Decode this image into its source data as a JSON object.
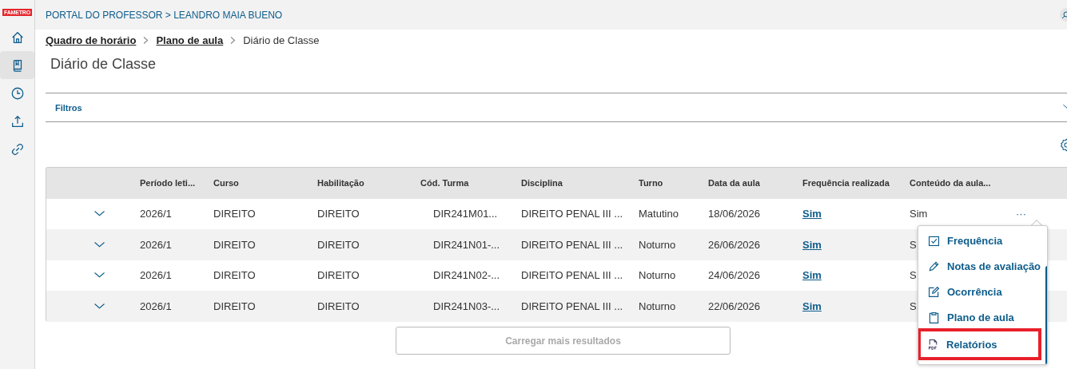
{
  "sidebar": {
    "logo": "FAMETRO",
    "items": [
      {
        "kind": "home",
        "selected": false
      },
      {
        "kind": "book",
        "selected": true
      },
      {
        "kind": "clock",
        "selected": false
      },
      {
        "kind": "upload",
        "selected": false
      },
      {
        "kind": "link",
        "selected": false
      }
    ]
  },
  "header": {
    "title": "PORTAL DO PROFESSOR > LEANDRO MAIA BUENO"
  },
  "breadcrumb": [
    {
      "label": "Quadro de horário",
      "kind": "link"
    },
    {
      "label": "Plano de aula",
      "kind": "link"
    },
    {
      "label": "Diário de Classe",
      "kind": "current"
    }
  ],
  "page_title": "Diário de Classe",
  "filters": {
    "label": "Filtros",
    "expanded": false
  },
  "table": {
    "columns": [
      {
        "label": "Período leti...",
        "kind": "text"
      },
      {
        "label": "Curso",
        "kind": "text"
      },
      {
        "label": "Habilitação",
        "kind": "text"
      },
      {
        "label": "Cód. Turma",
        "kind": "code"
      },
      {
        "label": "Disciplina",
        "kind": "text"
      },
      {
        "label": "Turno",
        "kind": "text"
      },
      {
        "label": "Data da aula",
        "kind": "text"
      },
      {
        "label": "Frequência realizada",
        "kind": "link"
      },
      {
        "label": "Conteúdo da aula...",
        "kind": "text"
      }
    ],
    "rows": [
      {
        "expanded": false,
        "cells": [
          "2026/1",
          "DIREITO",
          "DIREITO",
          "DIR241M01...",
          "DIREITO PENAL III ...",
          "Matutino",
          "18/06/2026",
          "Sim",
          "Sim"
        ],
        "actions": "···"
      },
      {
        "expanded": false,
        "cells": [
          "2026/1",
          "DIREITO",
          "DIREITO",
          "DIR241N01-...",
          "DIREITO PENAL III ...",
          "Noturno",
          "26/06/2026",
          "Sim",
          "S"
        ]
      },
      {
        "expanded": false,
        "cells": [
          "2026/1",
          "DIREITO",
          "DIREITO",
          "DIR241N02-...",
          "DIREITO PENAL III ...",
          "Noturno",
          "24/06/2026",
          "Sim",
          "S"
        ]
      },
      {
        "expanded": false,
        "cells": [
          "2026/1",
          "DIREITO",
          "DIREITO",
          "DIR241N03-...",
          "DIREITO PENAL III ...",
          "Noturno",
          "22/06/2026",
          "Sim",
          "S"
        ]
      }
    ]
  },
  "menu": {
    "items": [
      {
        "label": "Frequência",
        "kind": "check",
        "highlighted": false
      },
      {
        "label": "Notas de avaliação",
        "kind": "pencil",
        "highlighted": false
      },
      {
        "label": "Ocorrência",
        "kind": "edit",
        "highlighted": false
      },
      {
        "label": "Plano de aula",
        "kind": "clipboard",
        "highlighted": false
      },
      {
        "label": "Relatórios",
        "kind": "pdf",
        "highlighted": true
      }
    ]
  },
  "load_more": {
    "label": "Carregar mais resultados",
    "disabled": true
  }
}
